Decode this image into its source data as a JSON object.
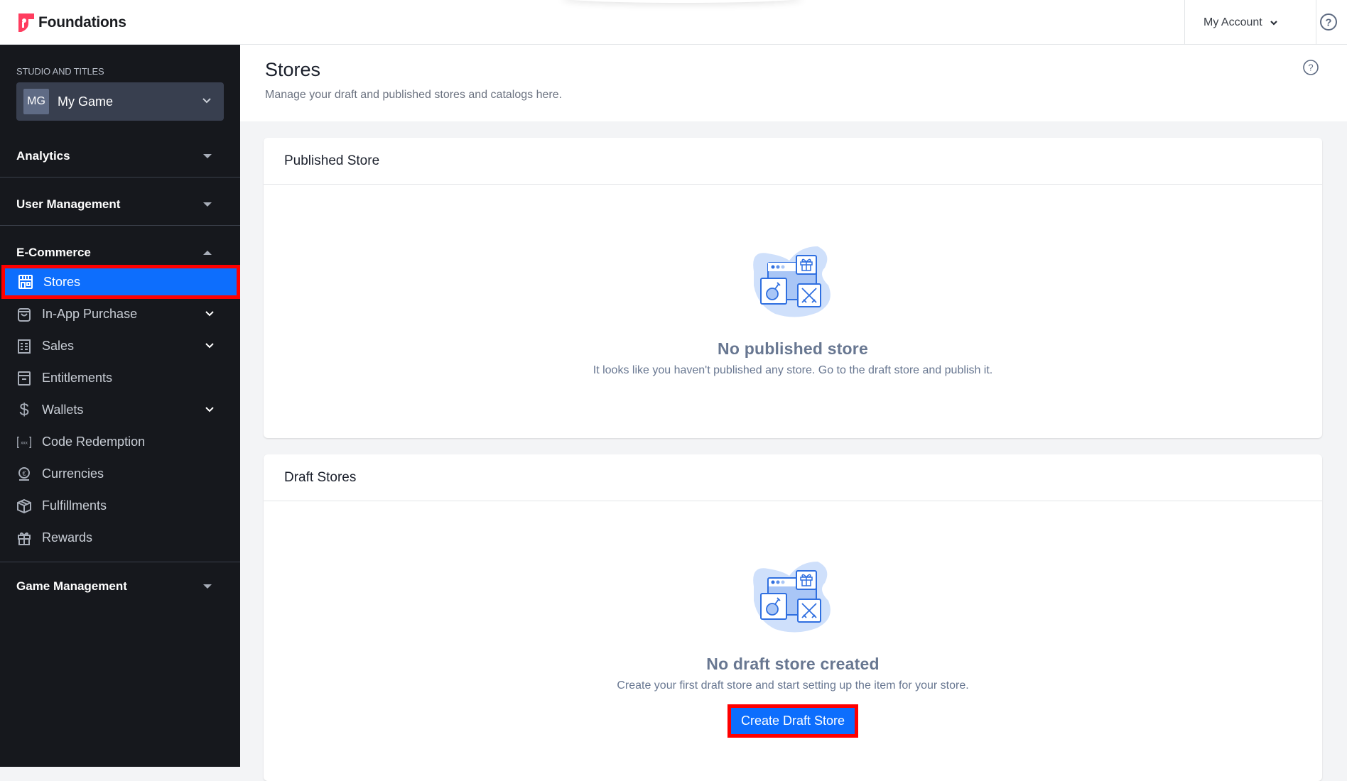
{
  "app": {
    "name": "Foundations",
    "brand_color": "#ff3d5f"
  },
  "topbar": {
    "account_label": "My Account",
    "help_icon": "help-circle-icon"
  },
  "sidebar": {
    "studio_label": "STUDIO AND TITLES",
    "studio": {
      "initials": "MG",
      "name": "My Game"
    },
    "sections": [
      {
        "label": "Analytics",
        "expanded": false
      },
      {
        "label": "User Management",
        "expanded": false
      },
      {
        "label": "E-Commerce",
        "expanded": true
      },
      {
        "label": "Game Management",
        "expanded": false
      }
    ],
    "ecommerce_items": [
      {
        "label": "Stores",
        "icon": "storefront-icon",
        "active": true,
        "has_submenu": false
      },
      {
        "label": "In-App Purchase",
        "icon": "shopping-bag-icon",
        "active": false,
        "has_submenu": true
      },
      {
        "label": "Sales",
        "icon": "receipt-icon",
        "active": false,
        "has_submenu": true
      },
      {
        "label": "Entitlements",
        "icon": "archive-icon",
        "active": false,
        "has_submenu": false
      },
      {
        "label": "Wallets",
        "icon": "dollar-icon",
        "active": false,
        "has_submenu": true
      },
      {
        "label": "Code Redemption",
        "icon": "code-brackets-icon",
        "active": false,
        "has_submenu": false
      },
      {
        "label": "Currencies",
        "icon": "coin-euro-icon",
        "active": false,
        "has_submenu": false
      },
      {
        "label": "Fulfillments",
        "icon": "box-icon",
        "active": false,
        "has_submenu": false
      },
      {
        "label": "Rewards",
        "icon": "gift-icon",
        "active": false,
        "has_submenu": false
      }
    ],
    "active_color": "#0d6efd"
  },
  "page": {
    "title": "Stores",
    "subtitle": "Manage your draft and published stores and catalogs here."
  },
  "published_card": {
    "title": "Published Store",
    "empty_title": "No published store",
    "empty_desc": "It looks like you haven't published any store. Go to the draft store and publish it."
  },
  "draft_card": {
    "title": "Draft Stores",
    "empty_title": "No draft store created",
    "empty_desc": "Create your first draft store and start setting up the item for your store.",
    "create_button": "Create Draft Store"
  },
  "highlight_color": "#ff0000"
}
